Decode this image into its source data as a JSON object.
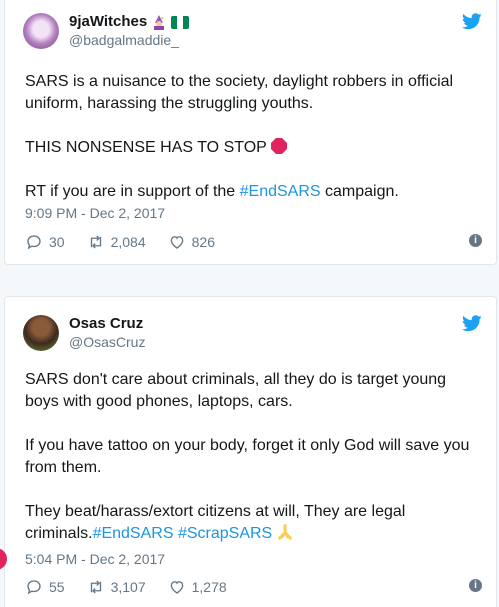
{
  "tweets": [
    {
      "display_name": "9jaWitches",
      "handle": "@badgalmaddie_",
      "lines": [
        "SARS is a nuisance to the society, daylight robbers in official uniform, harassing the struggling youths.",
        "THIS NONSENSE HAS TO STOP",
        "RT if you are in support of the ",
        "campaign."
      ],
      "hashtag": "#EndSARS",
      "timestamp": "9:09 PM - Dec 2, 2017",
      "replies": "30",
      "retweets": "2,084",
      "likes": "826"
    },
    {
      "display_name": "Osas Cruz",
      "handle": "@OsasCruz",
      "lines": [
        "SARS don't care about criminals, all they do is target young boys with good phones, laptops, cars.",
        "If you have tattoo on your body, forget it only God will save you from them.",
        "They beat/harass/extort citizens at will, They are legal criminals."
      ],
      "hashtags": [
        "#EndSARS",
        "#ScrapSARS"
      ],
      "timestamp": "5:04 PM - Dec 2, 2017",
      "replies": "55",
      "retweets": "3,107",
      "likes": "1,278"
    }
  ],
  "icons": {
    "bird": "twitter-bird-icon",
    "reply": "reply-icon",
    "retweet": "retweet-icon",
    "like": "heart-icon",
    "info": "info-icon"
  },
  "colors": {
    "twitter_blue": "#1da1f2",
    "hashtag": "#1b95e0",
    "muted": "#657786"
  }
}
